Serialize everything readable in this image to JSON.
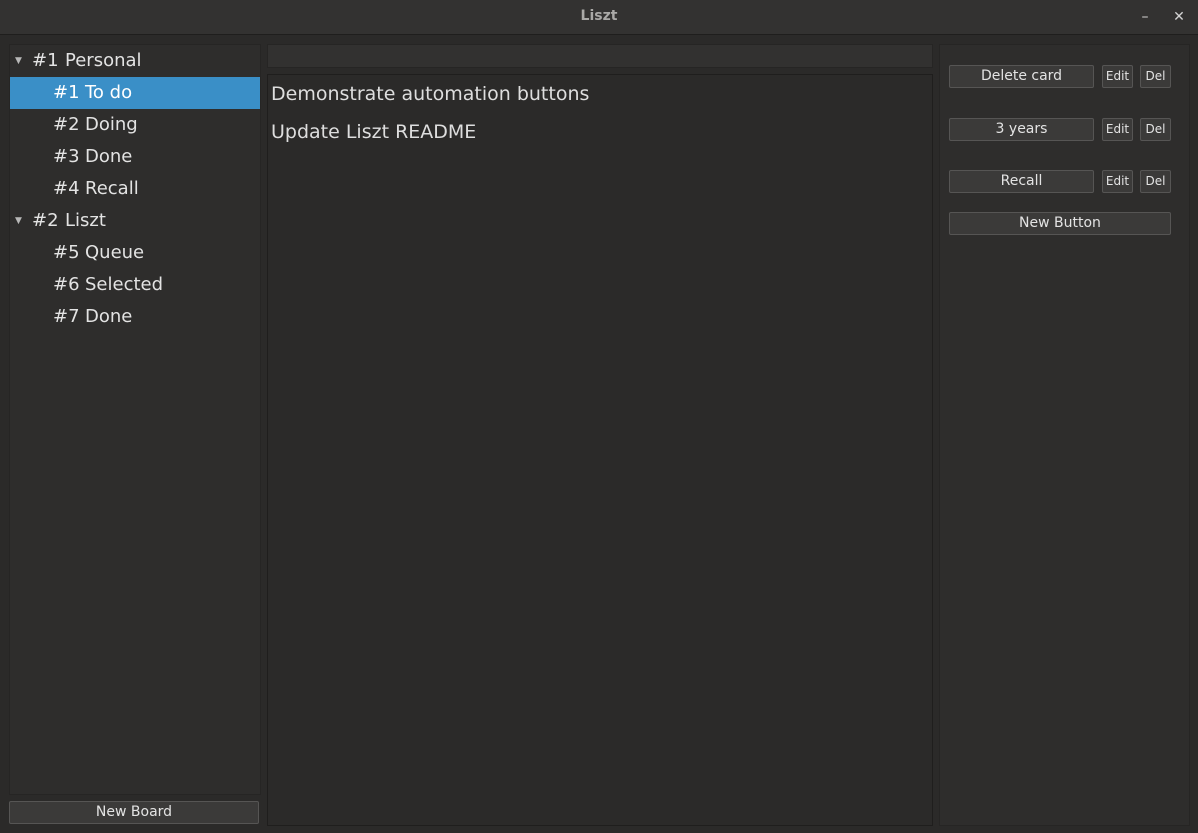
{
  "window": {
    "title": "Liszt",
    "minimize_glyph": "–",
    "close_glyph": "✕"
  },
  "sidebar": {
    "boards": [
      {
        "num": "#1",
        "name": "Personal",
        "expanded": true,
        "lists": [
          {
            "num": "#1",
            "name": "To do",
            "selected": true
          },
          {
            "num": "#2",
            "name": "Doing"
          },
          {
            "num": "#3",
            "name": "Done"
          },
          {
            "num": "#4",
            "name": "Recall"
          }
        ]
      },
      {
        "num": "#2",
        "name": "Liszt",
        "expanded": true,
        "lists": [
          {
            "num": "#5",
            "name": "Queue"
          },
          {
            "num": "#6",
            "name": "Selected"
          },
          {
            "num": "#7",
            "name": "Done"
          }
        ]
      }
    ],
    "new_board_label": "New Board"
  },
  "main": {
    "filter_value": "",
    "cards": [
      {
        "title": "Demonstrate automation buttons"
      },
      {
        "title": "Update Liszt README"
      }
    ]
  },
  "automation": {
    "buttons": [
      {
        "label": "Delete card",
        "edit_label": "Edit",
        "del_label": "Del"
      },
      {
        "label": "3 years",
        "edit_label": "Edit",
        "del_label": "Del"
      },
      {
        "label": "Recall",
        "edit_label": "Edit",
        "del_label": "Del"
      }
    ],
    "new_button_label": "New Button"
  },
  "colors": {
    "selection": "#3a8fc7",
    "background": "#2b2a29"
  }
}
